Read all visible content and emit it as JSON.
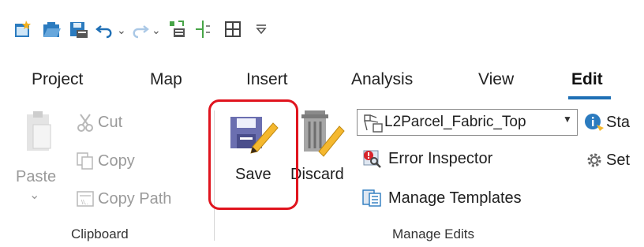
{
  "quick_access": {
    "icons": [
      "new-project-icon",
      "open-project-icon",
      "save-project-icon",
      "undo-icon",
      "redo-icon",
      "parcel-fabric-icon",
      "snapping-icon",
      "grid-icon",
      "customize-qat-icon"
    ]
  },
  "tabs": [
    {
      "label": "Project"
    },
    {
      "label": "Map"
    },
    {
      "label": "Insert"
    },
    {
      "label": "Analysis"
    },
    {
      "label": "View"
    },
    {
      "label": "Edit"
    }
  ],
  "clipboard": {
    "paste_label": "Paste",
    "cut_label": "Cut",
    "copy_label": "Copy",
    "copy_path_label": "Copy Path",
    "group_label": "Clipboard"
  },
  "manage_edits": {
    "save_label": "Save",
    "discard_label": "Discard",
    "layer_select_value": "L2Parcel_Fabric_Top",
    "error_inspector_label": "Error Inspector",
    "manage_templates_label": "Manage Templates",
    "group_label": "Manage Edits"
  },
  "partial": {
    "status_label": "Sta",
    "settings_label": "Set"
  },
  "colors": {
    "active_tab_underline": "#1f6fb5",
    "highlight_border": "#e0141e",
    "disabled_text": "#9a9a9a"
  }
}
